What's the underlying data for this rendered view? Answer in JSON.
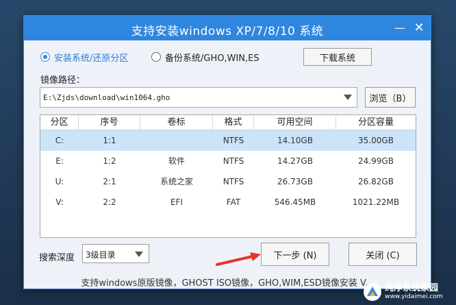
{
  "window": {
    "title": "支持安装windows XP/7/8/10 系统",
    "minimize_glyph": "—",
    "close_glyph": "✕"
  },
  "mode": {
    "install_label": "安装系统/还原分区",
    "install_checked": true,
    "backup_label": "备份系统/GHO,WIN,ES",
    "backup_checked": false,
    "download_button": "下载系统"
  },
  "image_path": {
    "label": "镜像路径：",
    "value": "E:\\Zjds\\download\\win1064.gho",
    "browse_button": "浏览（B）"
  },
  "partition_table": {
    "columns": [
      "分区",
      "序号",
      "卷标",
      "格式",
      "可用空间",
      "分区容量"
    ],
    "rows": [
      {
        "partition": "C:",
        "index": "1:1",
        "label": "",
        "format": "NTFS",
        "free": "14.10GB",
        "capacity": "35.00GB",
        "selected": true
      },
      {
        "partition": "E:",
        "index": "1:2",
        "label": "软件",
        "format": "NTFS",
        "free": "14.27GB",
        "capacity": "24.99GB",
        "selected": false
      },
      {
        "partition": "U:",
        "index": "2:1",
        "label": "系统之家",
        "format": "NTFS",
        "free": "26.73GB",
        "capacity": "26.82GB",
        "selected": false
      },
      {
        "partition": "V:",
        "index": "2:2",
        "label": "EFI",
        "format": "FAT",
        "free": "546.45MB",
        "capacity": "1021.22MB",
        "selected": false
      }
    ]
  },
  "search_depth": {
    "label": "搜索深度",
    "value": "3级目录"
  },
  "actions": {
    "next_button": "下一步 (N)",
    "close_button": "关闭 (C)"
  },
  "footer": {
    "text": "支持windows原版镜像，GHOST ISO镜像，GHO,WIM,ESD镜像安装 V..."
  },
  "watermark": {
    "title": "纯净系统家园",
    "url": "www.yidaimei.com"
  },
  "colors": {
    "titlebar": "#2f86de",
    "accent": "#2f7bd0",
    "selected_row": "#cce4f8",
    "annotation_arrow": "#e8322c"
  }
}
